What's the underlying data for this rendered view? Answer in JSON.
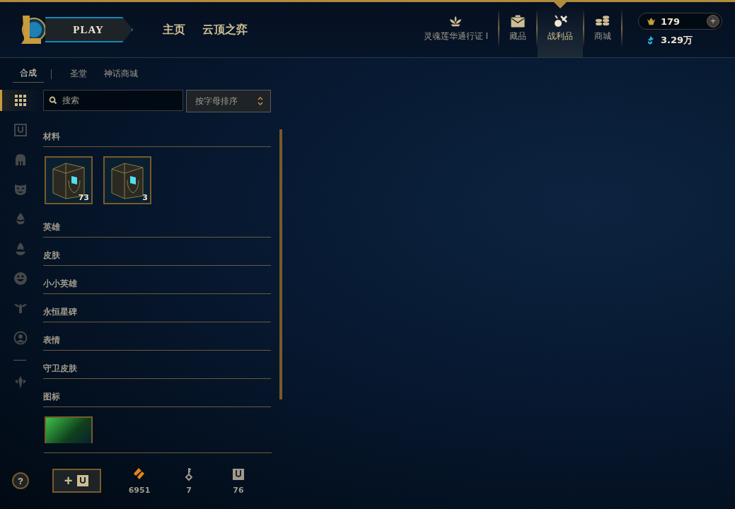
{
  "top_nav": {
    "play_label": "PLAY",
    "nav_links": [
      {
        "label": "主页"
      },
      {
        "label": "云顶之弈"
      }
    ],
    "nav_tabs": [
      {
        "kind": "lotus",
        "label": "灵魂莲华通行证 I",
        "selected": false
      },
      {
        "kind": "bag",
        "label": "藏品",
        "selected": false
      },
      {
        "kind": "loot",
        "label": "战利品",
        "selected": true
      },
      {
        "kind": "coins",
        "label": "商城",
        "selected": false
      }
    ],
    "wallet": {
      "rp": "179",
      "add": "+",
      "blue_essence": "3.29万"
    }
  },
  "sub_tabs": [
    {
      "label": "合成",
      "selected": true
    },
    {
      "label": "圣堂",
      "selected": false
    },
    {
      "label": "神话商城",
      "selected": false
    }
  ],
  "filter_rail": [
    {
      "kind": "grid",
      "selected": true
    },
    {
      "kind": "chest",
      "selected": false
    },
    {
      "kind": "helmet",
      "selected": false
    },
    {
      "kind": "mask",
      "selected": false
    },
    {
      "kind": "drop",
      "selected": false
    },
    {
      "kind": "flame",
      "selected": false
    },
    {
      "kind": "smiley",
      "selected": false
    },
    {
      "kind": "winged",
      "selected": false
    },
    {
      "kind": "portrait",
      "selected": false
    },
    {
      "kind": "divider"
    },
    {
      "kind": "ward",
      "selected": false
    }
  ],
  "search": {
    "placeholder": "搜索"
  },
  "sort": {
    "value": "按字母排序"
  },
  "sections": [
    {
      "title": "材料",
      "items": [
        {
          "kind": "chest",
          "count": "73"
        },
        {
          "kind": "chest",
          "count": "3"
        }
      ]
    },
    {
      "title": "英雄"
    },
    {
      "title": "皮肤"
    },
    {
      "title": "小小英雄"
    },
    {
      "title": "永恒星碑"
    },
    {
      "title": "表情"
    },
    {
      "title": "守卫皮肤"
    },
    {
      "title": "图标",
      "items": [
        {
          "kind": "icon"
        }
      ]
    }
  ],
  "footer": {
    "help": "?",
    "add_label": "+",
    "stats": [
      {
        "kind": "essence",
        "value": "6951"
      },
      {
        "kind": "key",
        "value": "7"
      },
      {
        "kind": "chest",
        "value": "76"
      }
    ]
  }
}
